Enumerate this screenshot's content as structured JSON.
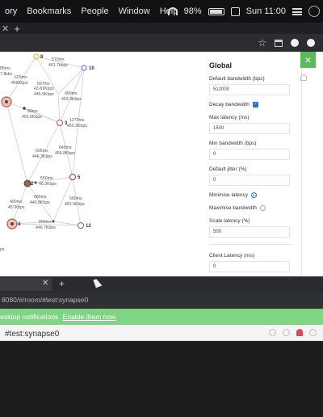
{
  "menubar": {
    "items": [
      "ory",
      "Bookmarks",
      "People",
      "Window",
      "Help"
    ],
    "battery": "98%",
    "clock": "Sun 11:00"
  },
  "top_window": {
    "graph": {
      "nodes": [
        {
          "id": "8",
          "label": "8"
        },
        {
          "id": "10",
          "label": "10"
        },
        {
          "id": "3",
          "label": "3"
        },
        {
          "id": "2",
          "label": "2"
        },
        {
          "id": "5",
          "label": "5"
        },
        {
          "id": "4",
          "label": "4"
        },
        {
          "id": "12",
          "label": "12"
        }
      ],
      "edge_labels": [
        "85ms",
        "7.8kbs",
        "625ms",
        "458Kbps",
        "570ms",
        "461.7kbps",
        "597ms",
        "43.81Kbps",
        "445.9Kbps",
        "490ms",
        "453.9Kbps",
        "65ms",
        "455.6Kbps",
        "1270ms",
        "455.3Kbps",
        "605ms",
        "446.3Kbps",
        "645ms",
        "456.8Kbps",
        "550ms",
        "46.3Kbps",
        "680ms",
        "440.8Kbps",
        "490ms",
        "457Kbps",
        "560ms",
        "462.5Kbps",
        "800ms",
        "446.7Kbps",
        "ps"
      ]
    },
    "settings": {
      "title": "Global",
      "default_bandwidth_label": "Default bandwidth (bps)",
      "default_bandwidth_value": "512000",
      "decay_bandwidth_label": "Decay bandwidth",
      "max_latency_label": "Max latency (ms)",
      "max_latency_value": "1500",
      "min_bandwidth_label": "Min bandwidth (bps)",
      "min_bandwidth_value": "0",
      "default_jitter_label": "Default jitter (%)",
      "default_jitter_value": "0",
      "minimise_latency_label": "Minimise latency",
      "maximise_bandwidth_label": "Maximise bandwidth",
      "scale_latency_label": "Scale latency (%)",
      "scale_latency_value": "500",
      "client_latency_label": "Client Latency (ms)",
      "client_latency_value": "0"
    },
    "close_label": "×"
  },
  "bottom_window": {
    "url": "8080/#/room/#test:synapse0",
    "notification_text": "esktop notifications",
    "notification_link": "Enable them now",
    "room_name": "#test:synapse0"
  },
  "colors": {
    "accent": "#2a6cde",
    "green": "#7fd584",
    "node_red": "#c0504d",
    "node_blue": "#3b6fd6"
  }
}
